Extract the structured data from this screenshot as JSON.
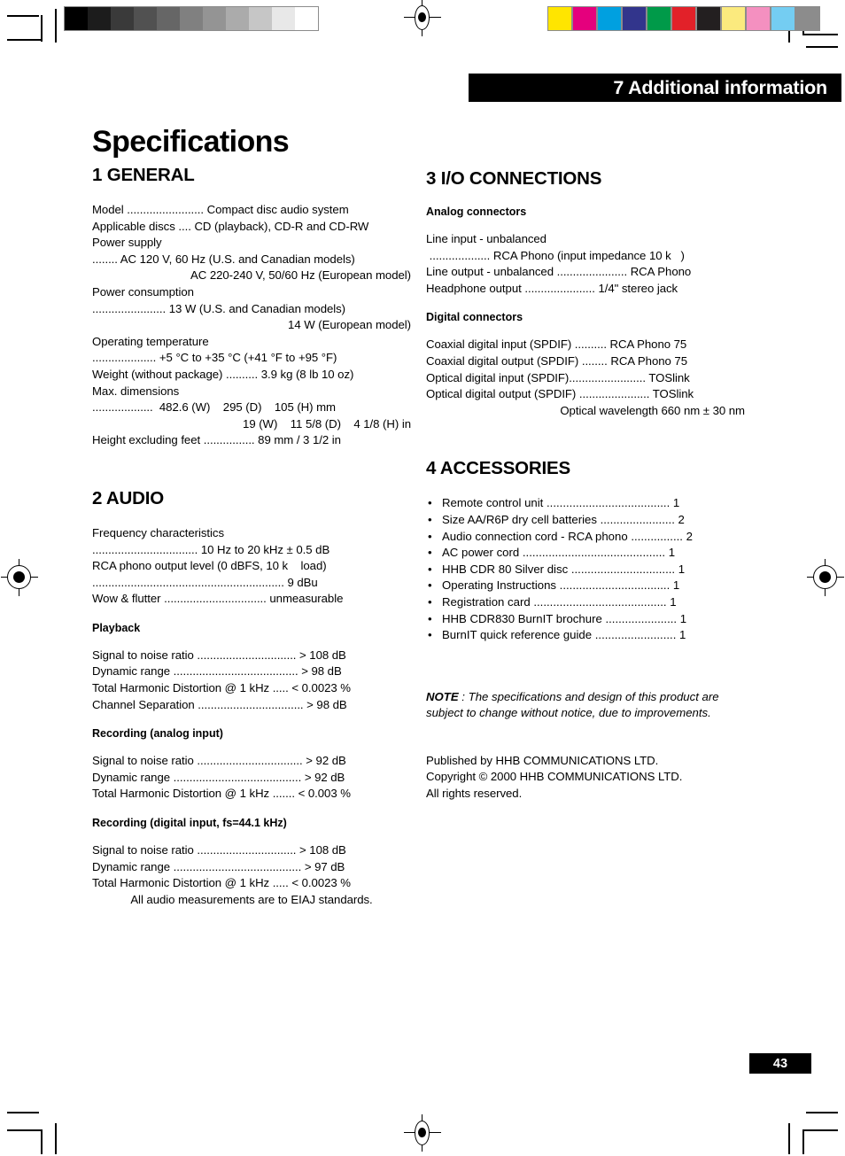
{
  "header": {
    "chapter_band": "7 Additional information",
    "doc_title": "Specifications"
  },
  "page_number": "43",
  "registration": {
    "gray_swatches": [
      "#000000",
      "#1c1c1c",
      "#3a3a3a",
      "#515151",
      "#666666",
      "#808080",
      "#949494",
      "#ababab",
      "#c6c6c6",
      "#e8e8e8",
      "#ffffff"
    ],
    "color_swatches": [
      "#ffe500",
      "#e5007d",
      "#00a0e0",
      "#32358c",
      "#009a49",
      "#e22129",
      "#231f20",
      "#fbea7e",
      "#f490c0",
      "#74cdf2",
      "#8c8c8c"
    ]
  },
  "left_column": {
    "section1": {
      "heading": "1 GENERAL",
      "lines": [
        "Model ........................ Compact disc audio system",
        "Applicable discs .... CD (playback), CD-R and CD-RW",
        "Power supply",
        "........ AC 120 V, 60 Hz (U.S. and Canadian models)",
        "AC 220-240 V, 50/60 Hz (European model)",
        "Power consumption",
        "....................... 13 W (U.S. and Canadian models)",
        "14 W (European model)",
        "Operating temperature",
        ".................... +5 °C to +35 °C (+41 °F to +95 °F)",
        "Weight (without package) .......... 3.9 kg (8 lb 10 oz)",
        "Max. dimensions",
        "...................  482.6 (W)    295 (D)    105 (H) mm",
        "19 (W)    11 5/8 (D)    4 1/8 (H) in",
        "Height excluding feet ................ 89 mm / 3 1/2 in"
      ],
      "right_aligned_indices": [
        4,
        7,
        13
      ]
    },
    "section2": {
      "heading": "2 AUDIO",
      "lines": [
        "Frequency characteristics",
        "................................. 10 Hz to 20 kHz ± 0.5 dB",
        "RCA phono output level (0 dBFS, 10 k    load)",
        "............................................................ 9 dBu",
        "Wow & flutter ................................ unmeasurable"
      ],
      "playback": {
        "heading": "Playback",
        "lines": [
          "Signal to noise ratio ............................... > 108 dB",
          "Dynamic range ....................................... > 98 dB",
          "Total Harmonic Distortion @ 1 kHz ..... < 0.0023 %",
          "Channel Separation ................................. > 98 dB"
        ]
      },
      "recording_analog": {
        "heading": "Recording (analog input)",
        "lines": [
          "Signal to noise ratio ................................. > 92 dB",
          "Dynamic range ........................................ > 92 dB",
          "Total Harmonic Distortion @ 1 kHz ....... < 0.003 %"
        ]
      },
      "recording_digital": {
        "heading": "Recording (digital input, fs=44.1 kHz)",
        "lines": [
          "Signal to noise ratio ............................... > 108 dB",
          "Dynamic range ........................................ > 97 dB",
          "Total Harmonic Distortion @ 1 kHz ..... < 0.0023 %"
        ],
        "footnote": "All audio measurements are to EIAJ standards."
      }
    }
  },
  "right_column": {
    "section3": {
      "heading": "3 I/O CONNECTIONS",
      "analog": {
        "heading": "Analog connectors",
        "lines": [
          "Line input - unbalanced",
          " ................... RCA Phono (input impedance 10 k   )",
          "Line output - unbalanced ...................... RCA Phono",
          "Headphone output ...................... 1/4\" stereo jack"
        ]
      },
      "digital": {
        "heading": "Digital connectors",
        "lines": [
          "Coaxial digital input (SPDIF) .......... RCA Phono 75",
          "Coaxial digital output (SPDIF) ........ RCA Phono 75",
          "Optical digital input (SPDIF)........................ TOSlink",
          "Optical digital output (SPDIF) ...................... TOSlink",
          "Optical wavelength 660 nm ± 30 nm"
        ],
        "right_aligned_indices": [
          4
        ]
      }
    },
    "section4": {
      "heading": "4 ACCESSORIES",
      "bullet": "•",
      "items": [
        "Remote control unit ...................................... 1",
        "Size AA/R6P dry cell batteries ....................... 2",
        "Audio connection cord - RCA phono ................ 2",
        "AC power cord ............................................ 1",
        "HHB CDR 80 Silver disc ................................ 1",
        "Operating Instructions .................................. 1",
        "Registration card ......................................... 1",
        "HHB CDR830 BurnIT brochure ...................... 1",
        "BurnIT quick reference guide ......................... 1"
      ]
    },
    "note": {
      "label": "NOTE",
      "text": " : The specifications and design of this product are subject to change without notice, due to improvements."
    },
    "publisher": {
      "lines": [
        "Published by HHB COMMUNICATIONS LTD.",
        "Copyright © 2000 HHB COMMUNICATIONS LTD.",
        "All rights reserved."
      ]
    }
  }
}
